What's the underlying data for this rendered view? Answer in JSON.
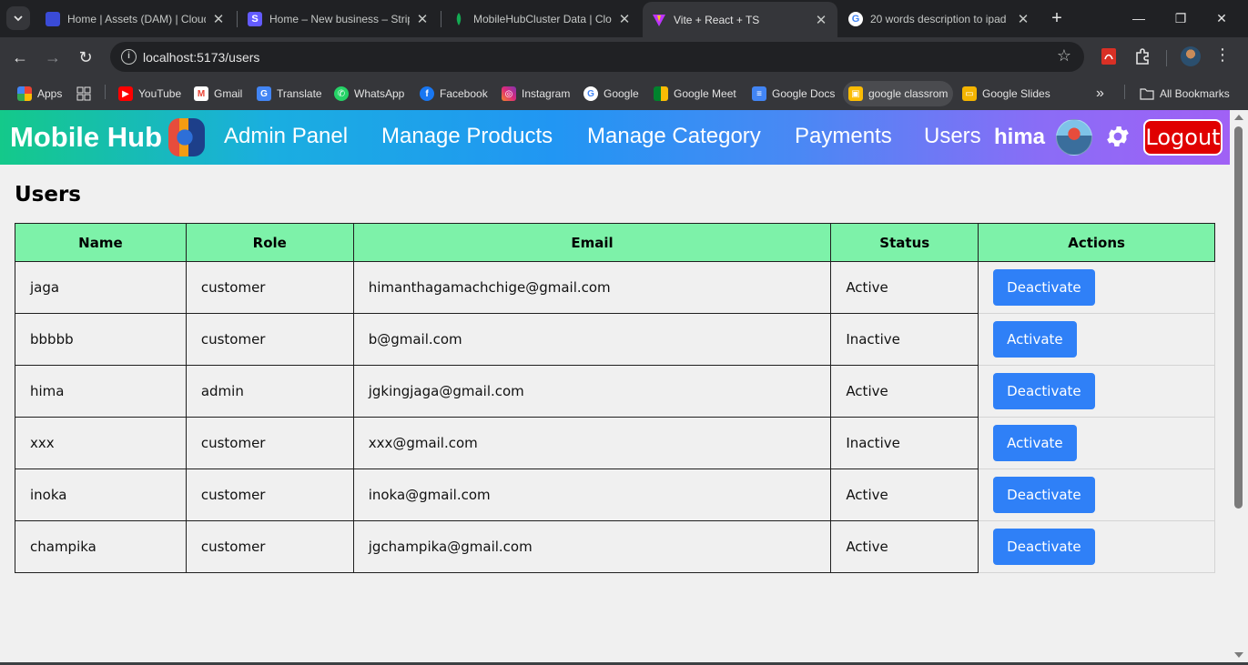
{
  "browser": {
    "tabs": [
      {
        "title": "Home | Assets (DAM) | Cloud",
        "color": "#3a4bd6"
      },
      {
        "title": "Home – New business – Strip",
        "color": "#635bff"
      },
      {
        "title": "MobileHubCluster Data | Clo",
        "color": "#13aa52"
      },
      {
        "title": "Vite + React + TS",
        "color": "#bd34fe"
      },
      {
        "title": "20 words description to ipad",
        "color": "#4285f4"
      }
    ],
    "url": "localhost:5173/users",
    "bookmarks": [
      {
        "label": "Apps",
        "icon": "apps-grid-icon"
      },
      {
        "label": "",
        "icon": "tab-groups-icon"
      },
      {
        "label": "YouTube",
        "icon": "youtube-icon"
      },
      {
        "label": "Gmail",
        "icon": "gmail-icon"
      },
      {
        "label": "Translate",
        "icon": "translate-icon"
      },
      {
        "label": "WhatsApp",
        "icon": "whatsapp-icon"
      },
      {
        "label": "Facebook",
        "icon": "facebook-icon"
      },
      {
        "label": "Instagram",
        "icon": "instagram-icon"
      },
      {
        "label": "Google",
        "icon": "google-icon"
      },
      {
        "label": "Google Meet",
        "icon": "google-meet-icon"
      },
      {
        "label": "Google Docs",
        "icon": "google-docs-icon"
      },
      {
        "label": "google classrom",
        "icon": "google-classroom-icon"
      },
      {
        "label": "Google Slides",
        "icon": "google-slides-icon"
      }
    ],
    "all_bookmarks": "All Bookmarks"
  },
  "navbar": {
    "brand": "Mobile Hub",
    "links": [
      "Admin Panel",
      "Manage Products",
      "Manage Category",
      "Payments",
      "Users"
    ],
    "username": "hima",
    "logout": "Logout"
  },
  "page": {
    "title": "Users",
    "columns": [
      "Name",
      "Role",
      "Email",
      "Status",
      "Actions"
    ],
    "rows": [
      {
        "name": "jaga",
        "role": "customer",
        "email": "himanthagamachchige@gmail.com",
        "status": "Active",
        "action": "Deactivate"
      },
      {
        "name": "bbbbb",
        "role": "customer",
        "email": "b@gmail.com",
        "status": "Inactive",
        "action": "Activate"
      },
      {
        "name": "hima",
        "role": "admin",
        "email": "jgkingjaga@gmail.com",
        "status": "Active",
        "action": "Deactivate"
      },
      {
        "name": "xxx",
        "role": "customer",
        "email": "xxx@gmail.com",
        "status": "Inactive",
        "action": "Activate"
      },
      {
        "name": "inoka",
        "role": "customer",
        "email": "inoka@gmail.com",
        "status": "Active",
        "action": "Deactivate"
      },
      {
        "name": "champika",
        "role": "customer",
        "email": "jgchampika@gmail.com",
        "status": "Active",
        "action": "Deactivate"
      }
    ]
  },
  "colors": {
    "header_green": "#7df2a9",
    "button_blue": "#2f80f7",
    "logout_red": "#e00000"
  }
}
